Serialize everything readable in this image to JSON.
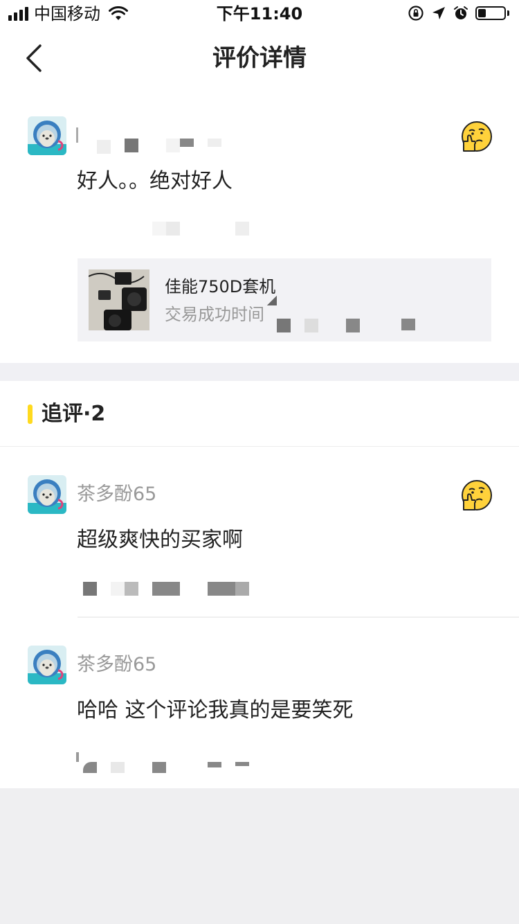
{
  "status_bar": {
    "carrier": "中国移动",
    "time": "下午11:40",
    "battery_level": 0.3
  },
  "nav": {
    "title": "评价详情"
  },
  "main_review": {
    "username": "",
    "comment": "好人。。绝对好人",
    "emoji": "thinking-thumb-emoji",
    "product": {
      "name": "佳能750D套机",
      "subtitle": "交易成功时间"
    }
  },
  "follow_up": {
    "title": "追评·2",
    "items": [
      {
        "username": "茶多酚65",
        "comment": "超级爽快的买家啊",
        "emoji": "thinking-thumb-emoji"
      },
      {
        "username": "茶多酚65",
        "comment": "哈哈 这个评论我真的是要笑死"
      }
    ]
  },
  "colors": {
    "accent": "#ffda1f",
    "muted_text": "#999999",
    "panel": "#f2f2f5",
    "emoji_yellow": "#ffd23b"
  }
}
